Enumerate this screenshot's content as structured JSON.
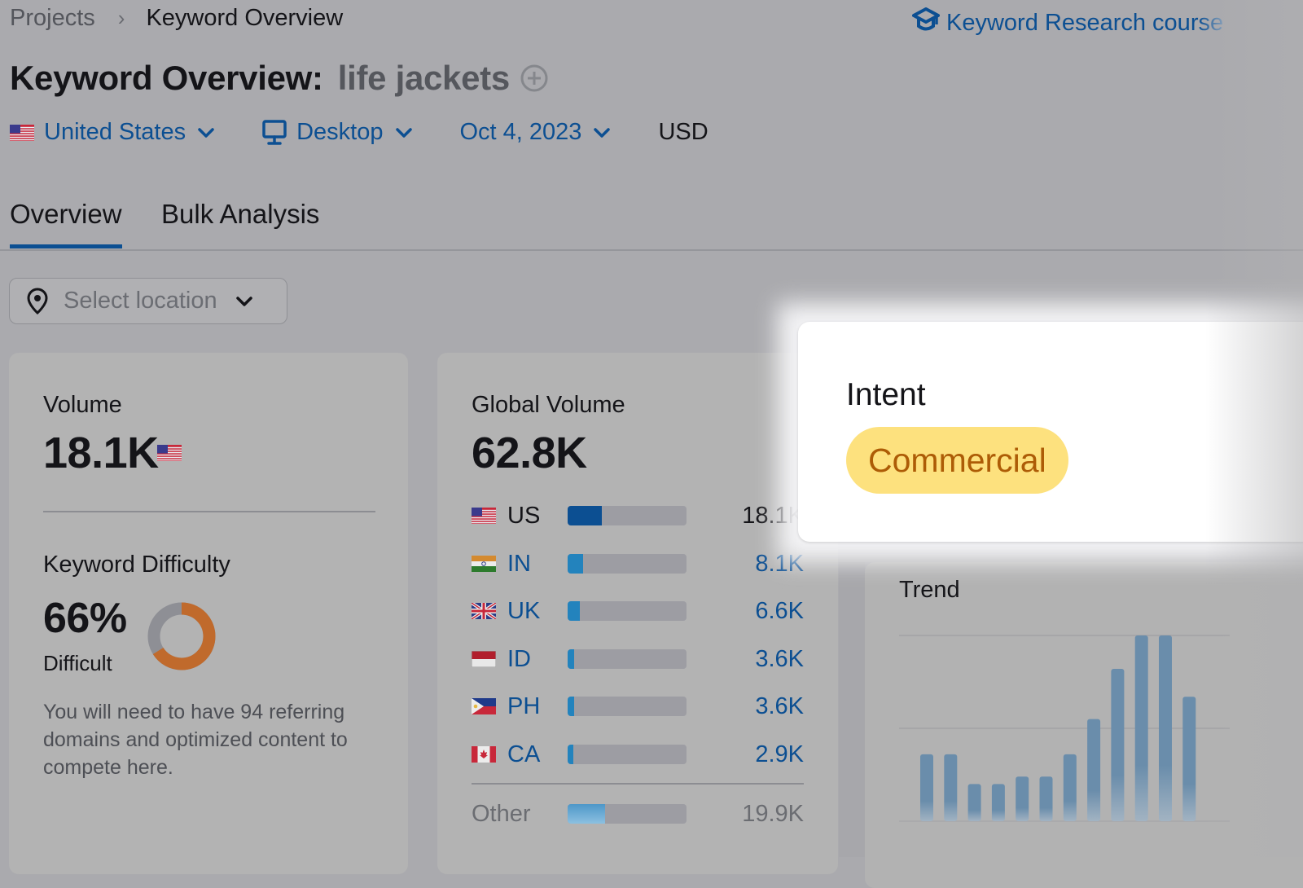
{
  "breadcrumb": {
    "parent": "Projects",
    "separator": "›",
    "current": "Keyword Overview"
  },
  "course_link": {
    "label_main": "Keyword Research cour",
    "label_fade": "se",
    "icon": "graduation-cap-icon"
  },
  "header": {
    "title": "Keyword Overview:",
    "keyword": "life jackets",
    "add_icon": "plus-circle-icon"
  },
  "filters": {
    "country": {
      "label": "United States",
      "flag": "us"
    },
    "device": {
      "label": "Desktop",
      "icon": "desktop-icon"
    },
    "date": {
      "label": "Oct 4, 2023"
    },
    "currency": "USD"
  },
  "tabs": [
    {
      "label": "Overview",
      "active": true
    },
    {
      "label": "Bulk Analysis",
      "active": false
    }
  ],
  "location_select": {
    "placeholder": "Select location"
  },
  "volume_card": {
    "label": "Volume",
    "value": "18.1K",
    "flag": "us",
    "kd_label": "Keyword Difficulty",
    "kd_value": "66%",
    "kd_percent": 66,
    "kd_level": "Difficult",
    "kd_color": "#c06a2c",
    "description": "You will need to have 94 referring domains and optimized content to compete here."
  },
  "global_card": {
    "label": "Global Volume",
    "value": "62.8K",
    "rows": [
      {
        "code": "US",
        "value": "18.1K",
        "share": 0.288,
        "flag": "us"
      },
      {
        "code": "IN",
        "value": "8.1K",
        "share": 0.129,
        "flag": "in"
      },
      {
        "code": "UK",
        "value": "6.6K",
        "share": 0.105,
        "flag": "uk"
      },
      {
        "code": "ID",
        "value": "3.6K",
        "share": 0.057,
        "flag": "id"
      },
      {
        "code": "PH",
        "value": "3.6K",
        "share": 0.057,
        "flag": "ph"
      },
      {
        "code": "CA",
        "value": "2.9K",
        "share": 0.046,
        "flag": "ca"
      }
    ],
    "other": {
      "label": "Other",
      "value": "19.9K",
      "share": 0.317
    }
  },
  "intent_card": {
    "label": "Intent",
    "badge": "Commercial",
    "badge_bg": "#fde17e",
    "badge_fg": "#ad5c06"
  },
  "trend_card": {
    "label": "Trend",
    "relative_values": [
      0.36,
      0.36,
      0.2,
      0.2,
      0.24,
      0.24,
      0.36,
      0.55,
      0.82,
      1.0,
      1.0,
      0.67
    ]
  }
}
